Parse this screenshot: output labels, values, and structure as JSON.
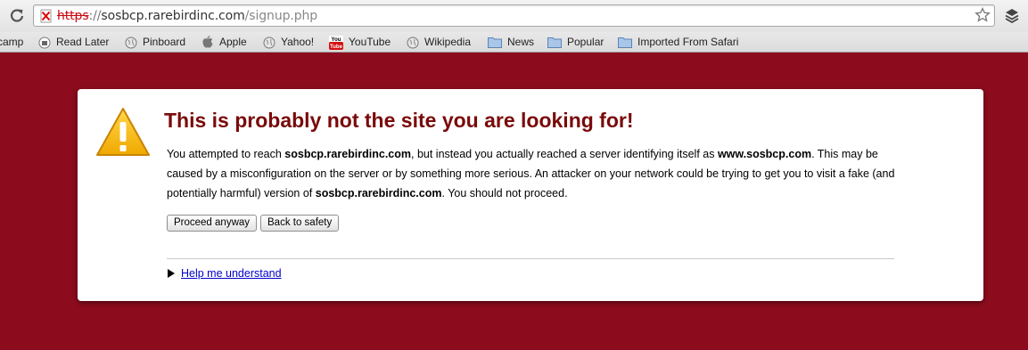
{
  "browser": {
    "url": {
      "scheme": "https",
      "separator": "://",
      "host": "sosbcp.rarebirdinc.com",
      "path": "/signup.php"
    }
  },
  "bookmarks": [
    {
      "label": "camp",
      "icon": "none"
    },
    {
      "label": "Read Later",
      "icon": "read-later-icon"
    },
    {
      "label": "Pinboard",
      "icon": "globe-icon"
    },
    {
      "label": "Apple",
      "icon": "apple-icon"
    },
    {
      "label": "Yahoo!",
      "icon": "globe-icon"
    },
    {
      "label": "YouTube",
      "icon": "youtube-icon"
    },
    {
      "label": "Wikipedia",
      "icon": "globe-icon"
    },
    {
      "label": "News",
      "icon": "folder-icon"
    },
    {
      "label": "Popular",
      "icon": "folder-icon"
    },
    {
      "label": "Imported From Safari",
      "icon": "folder-icon"
    }
  ],
  "interstitial": {
    "title": "This is probably not the site you are looking for!",
    "body": {
      "p1": "You attempted to reach ",
      "host": "sosbcp.rarebirdinc.com",
      "p2": ", but instead you actually reached a server identifying itself as ",
      "cert_host": "www.sosbcp.com",
      "p3": ". This may be caused by a misconfiguration on the server or by something more serious. An attacker on your network could be trying to get you to visit a fake (and potentially harmful) version of ",
      "host2": "sosbcp.rarebirdinc.com",
      "p4": ". You should not proceed."
    },
    "proceed_label": "Proceed anyway",
    "back_label": "Back to safety",
    "help_label": "Help me understand"
  },
  "colors": {
    "page_background": "#8c0c1d",
    "title": "#7a0a0a",
    "link": "#0000cc",
    "scheme_error": "#c8070f",
    "warning_yellow": "#f5b800"
  }
}
